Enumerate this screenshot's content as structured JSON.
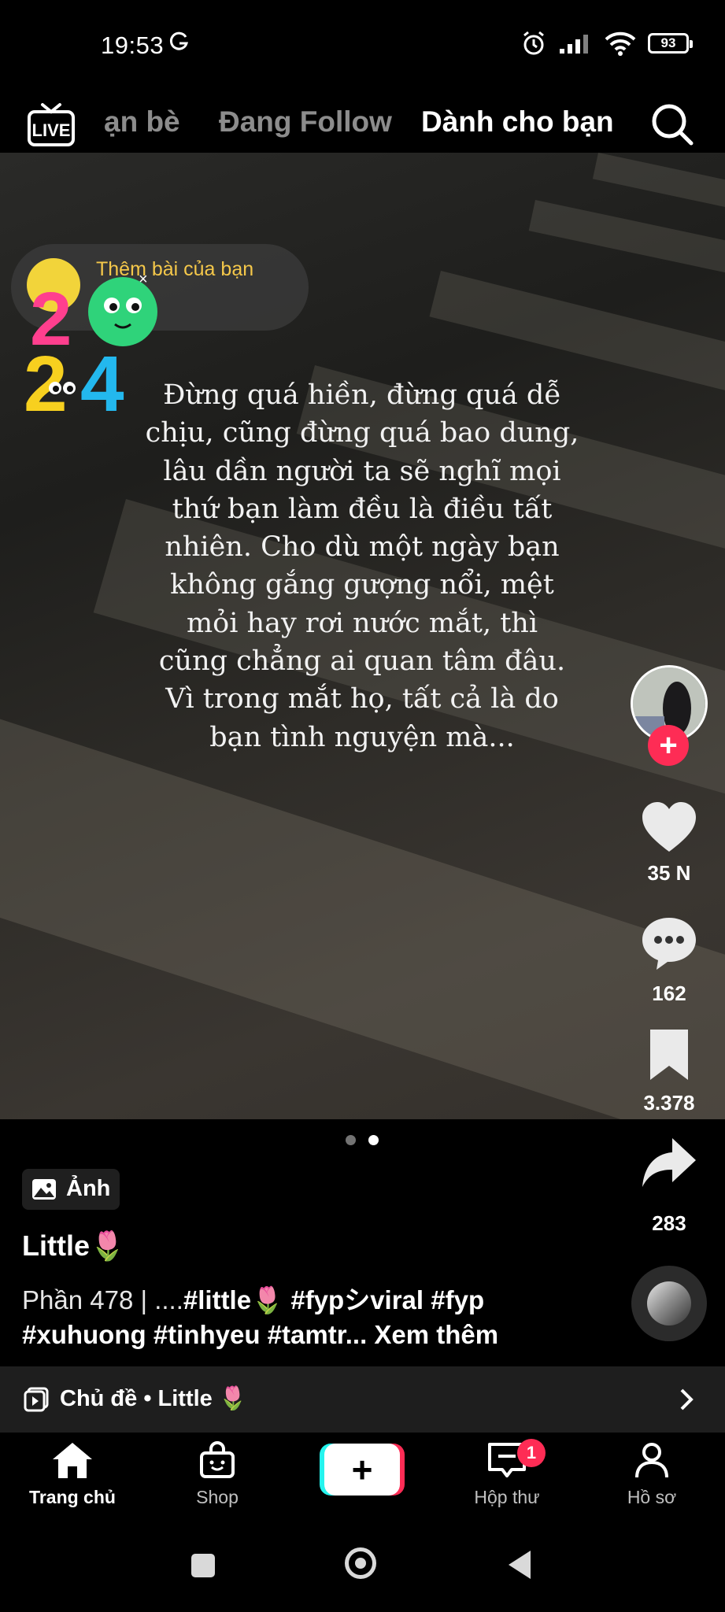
{
  "status_bar": {
    "time": "19:53",
    "carrier_icon": "google-g-icon",
    "battery": "93",
    "icons": [
      "alarm-icon",
      "signal-icon",
      "wifi-icon",
      "battery-icon"
    ]
  },
  "top_nav": {
    "live_label": "LIVE",
    "tabs": [
      {
        "label": "ạn bè",
        "active": false
      },
      {
        "label": "Đang Follow",
        "active": false
      },
      {
        "label": "Dành cho bạn",
        "active": true
      }
    ],
    "search_icon": "search-icon"
  },
  "post": {
    "add_post_prompt": "Thêm bài của bạn",
    "close": "×",
    "sticker_year": "2024",
    "quote_lines": [
      "Đừng quá hiền, đừng quá dễ",
      "chịu, cũng đừng quá bao dung,",
      "lâu dần người ta sẽ nghĩ mọi",
      "thứ bạn làm đều là điều tất",
      "nhiên. Cho dù một ngày bạn",
      "không gắng gượng nổi, mệt",
      "mỏi hay rơi nước mắt, thì",
      "cũng chẳng ai quan tâm đâu.",
      "Vì trong mắt họ, tất cả là do",
      "bạn tình nguyện mà..."
    ],
    "page_count": 2,
    "current_page": 2
  },
  "actions": {
    "follow_label": "+",
    "likes": "35 N",
    "comments": "162",
    "saves": "3.378",
    "shares": "283"
  },
  "caption": {
    "type_badge": "Ảnh",
    "username": "Little🌷",
    "line1_prefix": "Phần 478 | ....",
    "tag_little": "#little🌷",
    "tag_fyp_viral": "#fypシviral",
    "tag_fyp": "#fyp",
    "line2": "#xuhuong #tinhyeu #tamtr...",
    "see_more": "Xem thêm"
  },
  "topic": {
    "label": "Chủ đề • Little 🌷"
  },
  "bottom_nav": {
    "home": "Trang chủ",
    "shop": "Shop",
    "create": "+",
    "inbox": "Hộp thư",
    "inbox_badge": "1",
    "profile": "Hồ sơ"
  },
  "colors": {
    "accent": "#fe2c55",
    "cyan": "#25f4ee",
    "prompt_yellow": "#f5c84a"
  }
}
